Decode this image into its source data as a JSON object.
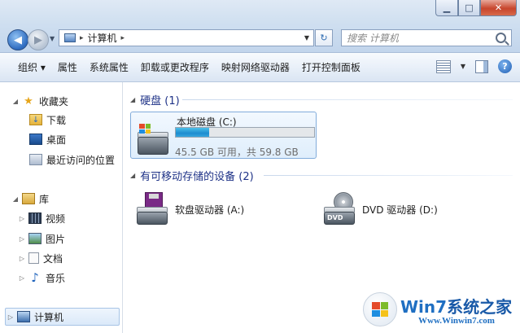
{
  "window": {
    "minimize": "▁",
    "maximize": "□",
    "close": "✕"
  },
  "address_bar": {
    "separator": "▸",
    "location": "计算机",
    "separator_after": "▸",
    "icon": "computer-icon"
  },
  "search": {
    "placeholder": "搜索 计算机"
  },
  "toolbar": {
    "organize": "组织 ▾",
    "properties": "属性",
    "system_properties": "系统属性",
    "uninstall": "卸载或更改程序",
    "map_drive": "映射网络驱动器",
    "control_panel": "打开控制面板"
  },
  "sidebar": {
    "favorites": {
      "label": "收藏夹",
      "items": [
        "下载",
        "桌面",
        "最近访问的位置"
      ]
    },
    "libraries": {
      "label": "库",
      "items": [
        "视频",
        "图片",
        "文档",
        "音乐"
      ]
    },
    "computer": "计算机"
  },
  "main": {
    "hard_disks": {
      "title": "硬盘 (1)",
      "drive_c": {
        "name": "本地磁盘 (C:)",
        "space": "45.5 GB 可用，共 59.8 GB",
        "used_fraction": 0.24
      }
    },
    "removable": {
      "title": "有可移动存储的设备 (2)",
      "floppy": "软盘驱动器 (A:)",
      "dvd": "DVD 驱动器 (D:)",
      "dvd_label": "DVD"
    }
  },
  "watermark": {
    "brand_prefix": "Win7",
    "brand_suffix": "系统之家",
    "url": "Www.Winwin7.com"
  },
  "colors": {
    "accent": "#1e3287",
    "capacity": "#1d8ccf",
    "selection": "#dbe9f9"
  }
}
